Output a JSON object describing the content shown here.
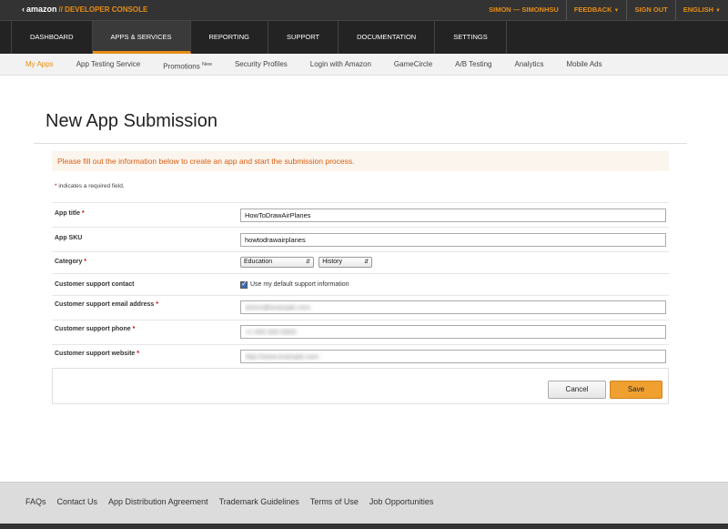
{
  "topbar": {
    "brand": "amazon",
    "console": "// DEVELOPER CONSOLE",
    "user": "SIMON — SIMONHSU",
    "feedback": "FEEDBACK",
    "signout": "SIGN OUT",
    "language": "ENGLISH"
  },
  "mainnav": {
    "items": [
      "DASHBOARD",
      "APPS & SERVICES",
      "REPORTING",
      "SUPPORT",
      "DOCUMENTATION",
      "SETTINGS"
    ],
    "active_index": 1
  },
  "subnav": {
    "items": [
      "My Apps",
      "App Testing Service",
      "Promotions",
      "Security Profiles",
      "Login with Amazon",
      "GameCircle",
      "A/B Testing",
      "Analytics",
      "Mobile Ads"
    ],
    "promotions_badge": "New",
    "active_index": 0
  },
  "page": {
    "title": "New App Submission",
    "notice": "Please fill out the information below to create an app and start the submission process.",
    "required_star": "*",
    "required_note": "indicates a required field."
  },
  "form": {
    "app_title_label": "App title",
    "app_title_value": "HowToDrawAirPlanes",
    "app_sku_label": "App SKU",
    "app_sku_value": "howtodrawairplanes",
    "category_label": "Category",
    "category_value": "Education",
    "subcategory_value": "History",
    "support_contact_label": "Customer support contact",
    "default_support_label": "Use my default support information",
    "support_email_label": "Customer support email address",
    "support_email_value": "simon@example.com",
    "support_phone_label": "Customer support phone",
    "support_phone_value": "+1 000 000 0000",
    "support_website_label": "Customer support website",
    "support_website_value": "http://www.example.com"
  },
  "buttons": {
    "cancel": "Cancel",
    "save": "Save"
  },
  "footer": {
    "links": [
      "FAQs",
      "Contact Us",
      "App Distribution Agreement",
      "Trademark Guidelines",
      "Terms of Use",
      "Job Opportunities"
    ]
  },
  "colors": {
    "accent": "#e88d14",
    "notice_text": "#d95d0f",
    "notice_bg": "#fcf5ee",
    "topbar_bg": "#333333"
  }
}
